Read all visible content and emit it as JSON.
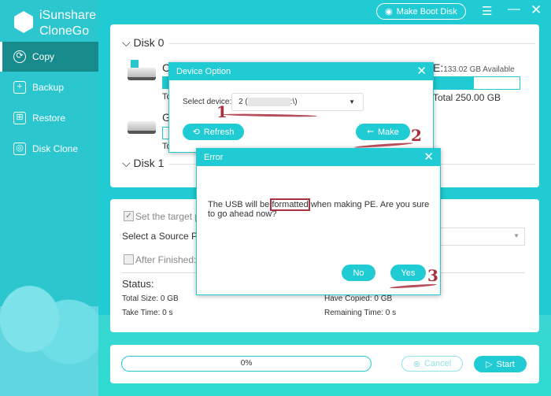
{
  "app": {
    "name_line1": "iSunshare",
    "name_line2": "CloneGo"
  },
  "topbar": {
    "make_boot_disk": "Make Boot Disk",
    "menu_icon": "menu-icon",
    "minimize_icon": "minimize-icon",
    "close_icon": "close-icon"
  },
  "sidebar": {
    "items": [
      {
        "label": "Copy",
        "icon": "copy-icon",
        "active": true
      },
      {
        "label": "Backup",
        "icon": "backup-icon"
      },
      {
        "label": "Restore",
        "icon": "restore-icon"
      },
      {
        "label": "Disk Clone",
        "icon": "disk-clone-icon"
      }
    ]
  },
  "disks": {
    "disk0": "Disk 0",
    "disk1": "Disk 1",
    "c_letter": "C",
    "c_total": "To",
    "g_letter": "G",
    "g_total": "To",
    "e_letter": "E:",
    "e_available": "133.02 GB Available",
    "e_total": "Total 250.00 GB",
    "e_used_fraction": 0.47
  },
  "options": {
    "set_target": "Set the target pa",
    "set_target_checked": true,
    "select_source": "Select a Source Pa",
    "dropdown_partial": "t:",
    "after_finished": "After Finished:",
    "after_finished_checked": false
  },
  "status": {
    "title": "Status:",
    "total_size": "Total Size: 0 GB",
    "have_copied": "Have Copied: 0 GB",
    "take_time": "Take Time: 0 s",
    "remaining_time": "Remaining Time: 0 s"
  },
  "bottom": {
    "progress": "0%",
    "progress_value": 0,
    "cancel": "Cancel",
    "start": "Start"
  },
  "device_dialog": {
    "title": "Device Option",
    "select_label": "Select device:",
    "selected_prefix": "2 (",
    "selected_suffix": ":\\)",
    "refresh": "Refresh",
    "make": "Make"
  },
  "error_dialog": {
    "title": "Error",
    "msg_before": "The USB will be ",
    "msg_highlight": "formatted",
    "msg_after": " when making PE. Are you sure to go ahead now?",
    "no": "No",
    "yes": "Yes"
  },
  "annotations": {
    "step1": "1",
    "step2": "2",
    "step3": "3",
    "color": "#a8303f"
  },
  "colors": {
    "accent": "#20cbd3",
    "sidebar_active": "#178b8c"
  }
}
